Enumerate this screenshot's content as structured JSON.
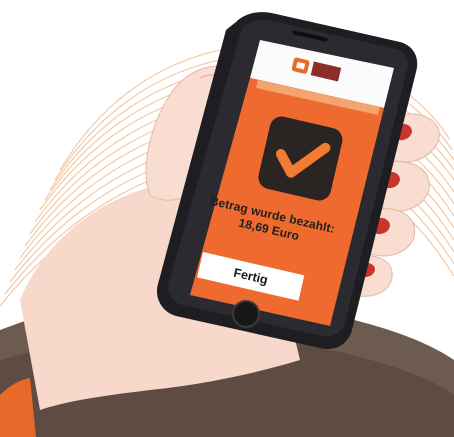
{
  "payment_screen": {
    "message_line1": "Betrag wurde bezahlt:",
    "message_line2": "18,69 Euro",
    "done_button_label": "Fertig"
  },
  "icons": {
    "brand_logo": "app-logo-icon",
    "success_check": "checkmark-icon",
    "home": "home-button-icon"
  },
  "colors": {
    "screen_accent": "#EE6A2E",
    "check_tile": "#2A2422",
    "check_mark": "#F27A33",
    "background_wave": "#F2B98C",
    "sleeve": "#6B5A4F",
    "skin": "#F7D6C8",
    "nail": "#C9352B"
  }
}
